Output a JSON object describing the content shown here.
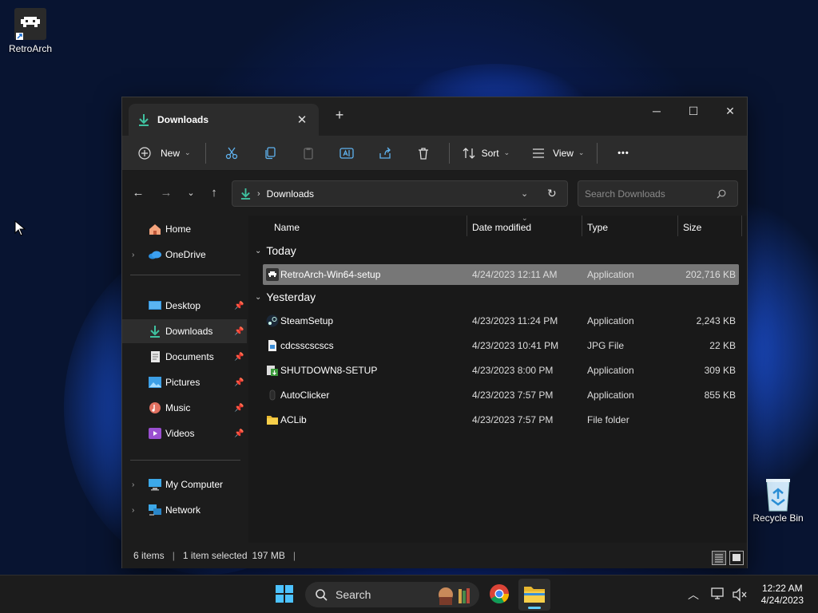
{
  "desktop": {
    "icons": [
      {
        "label": "RetroArch"
      },
      {
        "label": "Recycle Bin"
      }
    ]
  },
  "window": {
    "tab_title": "Downloads",
    "tab_close": "✕",
    "new_tab": "+",
    "controls": {
      "minimize": "─",
      "maximize": "☐",
      "close": "✕"
    }
  },
  "commandbar": {
    "new_label": "New",
    "sort_label": "Sort",
    "view_label": "View",
    "more_label": "•••"
  },
  "address": {
    "path": "Downloads",
    "search_placeholder": "Search Downloads"
  },
  "sidebar": {
    "items": [
      {
        "label": "Home"
      },
      {
        "label": "OneDrive"
      },
      {
        "label": "Desktop"
      },
      {
        "label": "Downloads"
      },
      {
        "label": "Documents"
      },
      {
        "label": "Pictures"
      },
      {
        "label": "Music"
      },
      {
        "label": "Videos"
      },
      {
        "label": "My Computer"
      },
      {
        "label": "Network"
      }
    ]
  },
  "columns": {
    "name": "Name",
    "date": "Date modified",
    "type": "Type",
    "size": "Size"
  },
  "groups": {
    "today": "Today",
    "yesterday": "Yesterday"
  },
  "files": [
    {
      "name": "RetroArch-Win64-setup",
      "date": "4/24/2023 12:11 AM",
      "type": "Application",
      "size": "202,716 KB"
    },
    {
      "name": "SteamSetup",
      "date": "4/23/2023 11:24 PM",
      "type": "Application",
      "size": "2,243 KB"
    },
    {
      "name": "cdcsscscscs",
      "date": "4/23/2023 10:41 PM",
      "type": "JPG File",
      "size": "22 KB"
    },
    {
      "name": "SHUTDOWN8-SETUP",
      "date": "4/23/2023 8:00 PM",
      "type": "Application",
      "size": "309 KB"
    },
    {
      "name": "AutoClicker",
      "date": "4/23/2023 7:57 PM",
      "type": "Application",
      "size": "855 KB"
    },
    {
      "name": "ACLib",
      "date": "4/23/2023 7:57 PM",
      "type": "File folder",
      "size": ""
    }
  ],
  "status": {
    "items": "6 items",
    "selected": "1 item selected",
    "size": "197 MB"
  },
  "taskbar": {
    "search_label": "Search",
    "time": "12:22 AM",
    "date": "4/24/2023"
  },
  "colors": {
    "accent": "#0a84d4",
    "selection": "#777777",
    "folder": "#f2c94c"
  }
}
